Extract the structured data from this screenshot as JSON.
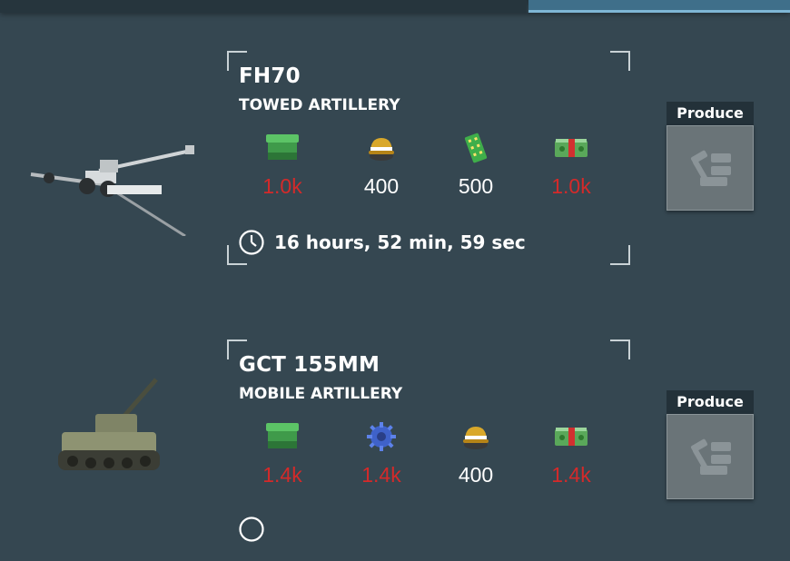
{
  "units": [
    {
      "name": "FH70",
      "type": "TOWED ARTILLERY",
      "resources": [
        {
          "icon": "supplies-crate-icon",
          "value": "1.0k",
          "status": "short"
        },
        {
          "icon": "helmet-icon",
          "value": "400",
          "status": "ok"
        },
        {
          "icon": "components-chip-icon",
          "value": "500",
          "status": "ok"
        },
        {
          "icon": "cash-icon",
          "value": "1.0k",
          "status": "short"
        }
      ],
      "time": "16 hours, 52 min, 59 sec",
      "produce_label": "Produce"
    },
    {
      "name": "GCT 155MM",
      "type": "MOBILE ARTILLERY",
      "resources": [
        {
          "icon": "supplies-crate-icon",
          "value": "1.4k",
          "status": "short"
        },
        {
          "icon": "gear-icon",
          "value": "1.4k",
          "status": "short"
        },
        {
          "icon": "helmet-icon",
          "value": "400",
          "status": "ok"
        },
        {
          "icon": "cash-icon",
          "value": "1.4k",
          "status": "short"
        }
      ],
      "produce_label": "Produce"
    }
  ],
  "colors": {
    "background": "#354751",
    "shortage": "#d42a2a",
    "available": "#ffffff",
    "active_tab": "#3f6f8a"
  }
}
